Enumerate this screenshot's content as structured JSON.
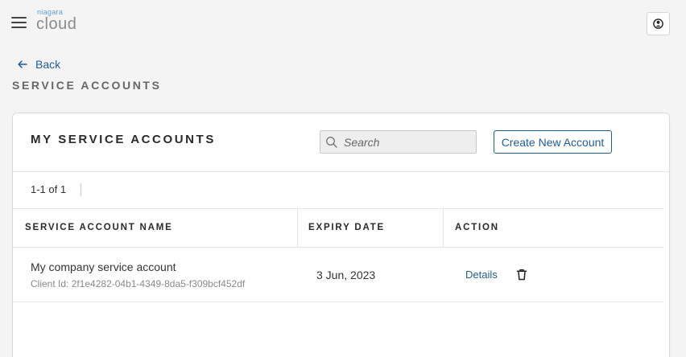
{
  "header": {
    "logo_top": "niagara",
    "logo_main": "cloud",
    "menu_icon": "hamburger-menu-icon",
    "user_icon": "user-icon"
  },
  "nav": {
    "back_label": "Back"
  },
  "page": {
    "title": "SERVICE ACCOUNTS"
  },
  "card": {
    "title": "MY SERVICE ACCOUNTS",
    "search_placeholder": "Search",
    "create_button": "Create New Account",
    "pagination": "1-1 of 1"
  },
  "table": {
    "columns": [
      "SERVICE ACCOUNT NAME",
      "EXPIRY DATE",
      "ACTION"
    ],
    "rows": [
      {
        "name": "My company service account",
        "client_id": "Client Id: 2f1e4282-04b1-4349-8da5-f309bcf452df",
        "expiry": "3 Jun, 2023",
        "details_label": "Details"
      }
    ]
  },
  "colors": {
    "link": "#1f5e94",
    "logo_accent": "#5aa5d8",
    "background": "#f4f4f4"
  }
}
